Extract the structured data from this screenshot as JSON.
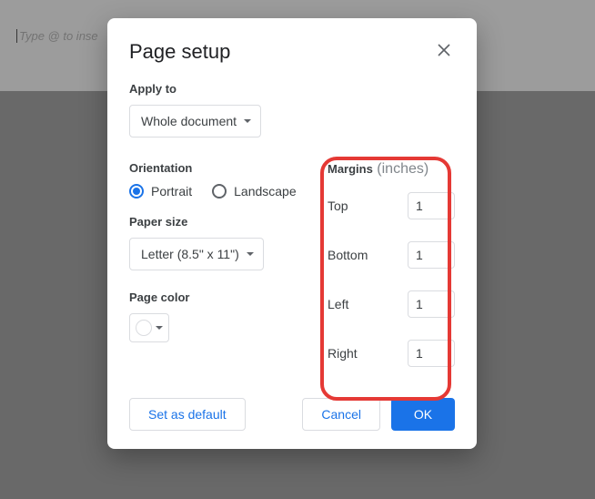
{
  "doc": {
    "placeholder_text": "Type @ to inse"
  },
  "dialog": {
    "title": "Page setup",
    "apply_to": {
      "label": "Apply to",
      "value": "Whole document"
    },
    "orientation": {
      "label": "Orientation",
      "portrait": "Portrait",
      "landscape": "Landscape"
    },
    "paper_size": {
      "label": "Paper size",
      "value": "Letter (8.5\" x 11\")"
    },
    "page_color": {
      "label": "Page color"
    },
    "margins": {
      "label": "Margins",
      "unit": "(inches)",
      "top_label": "Top",
      "bottom_label": "Bottom",
      "left_label": "Left",
      "right_label": "Right",
      "top": "1",
      "bottom": "1",
      "left": "1",
      "right": "1"
    },
    "buttons": {
      "set_default": "Set as default",
      "cancel": "Cancel",
      "ok": "OK"
    }
  }
}
